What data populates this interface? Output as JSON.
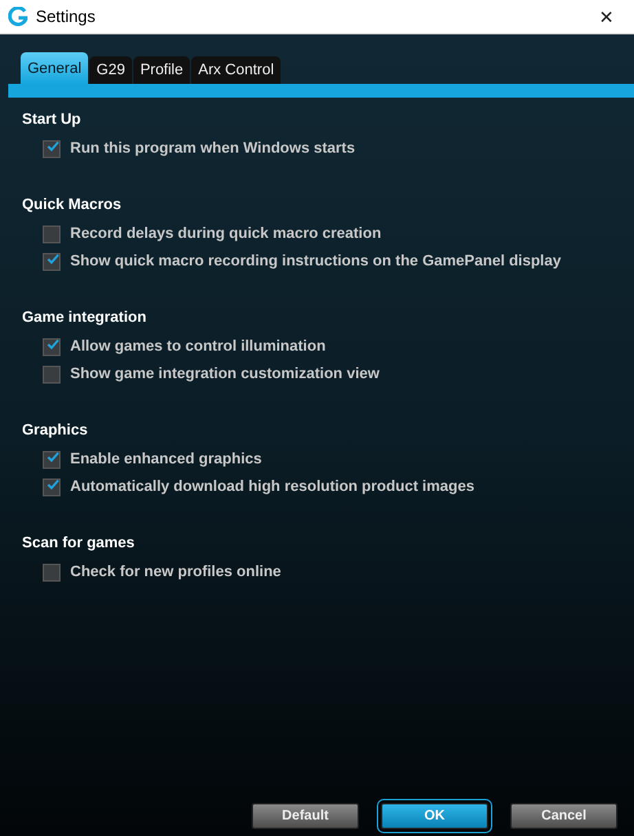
{
  "window": {
    "title": "Settings",
    "close": "✕"
  },
  "tabs": [
    {
      "label": "General",
      "selected": true
    },
    {
      "label": "G29",
      "selected": false
    },
    {
      "label": "Profile",
      "selected": false
    },
    {
      "label": "Arx Control",
      "selected": false
    }
  ],
  "sections": [
    {
      "heading": "Start Up",
      "options": [
        {
          "label": "Run this program when Windows starts",
          "checked": true
        }
      ]
    },
    {
      "heading": "Quick Macros",
      "options": [
        {
          "label": "Record delays during quick macro creation",
          "checked": false
        },
        {
          "label": "Show quick macro recording instructions on the GamePanel display",
          "checked": true
        }
      ]
    },
    {
      "heading": "Game integration",
      "options": [
        {
          "label": "Allow games to control illumination",
          "checked": true
        },
        {
          "label": "Show game integration customization view",
          "checked": false
        }
      ]
    },
    {
      "heading": "Graphics",
      "options": [
        {
          "label": "Enable enhanced graphics",
          "checked": true
        },
        {
          "label": "Automatically download high resolution product images",
          "checked": true
        }
      ]
    },
    {
      "heading": "Scan for games",
      "options": [
        {
          "label": "Check for new profiles online",
          "checked": false
        }
      ]
    }
  ],
  "buttons": [
    {
      "label": "Default",
      "kind": "secondary"
    },
    {
      "label": "OK",
      "kind": "primary"
    },
    {
      "label": "Cancel",
      "kind": "secondary"
    }
  ]
}
